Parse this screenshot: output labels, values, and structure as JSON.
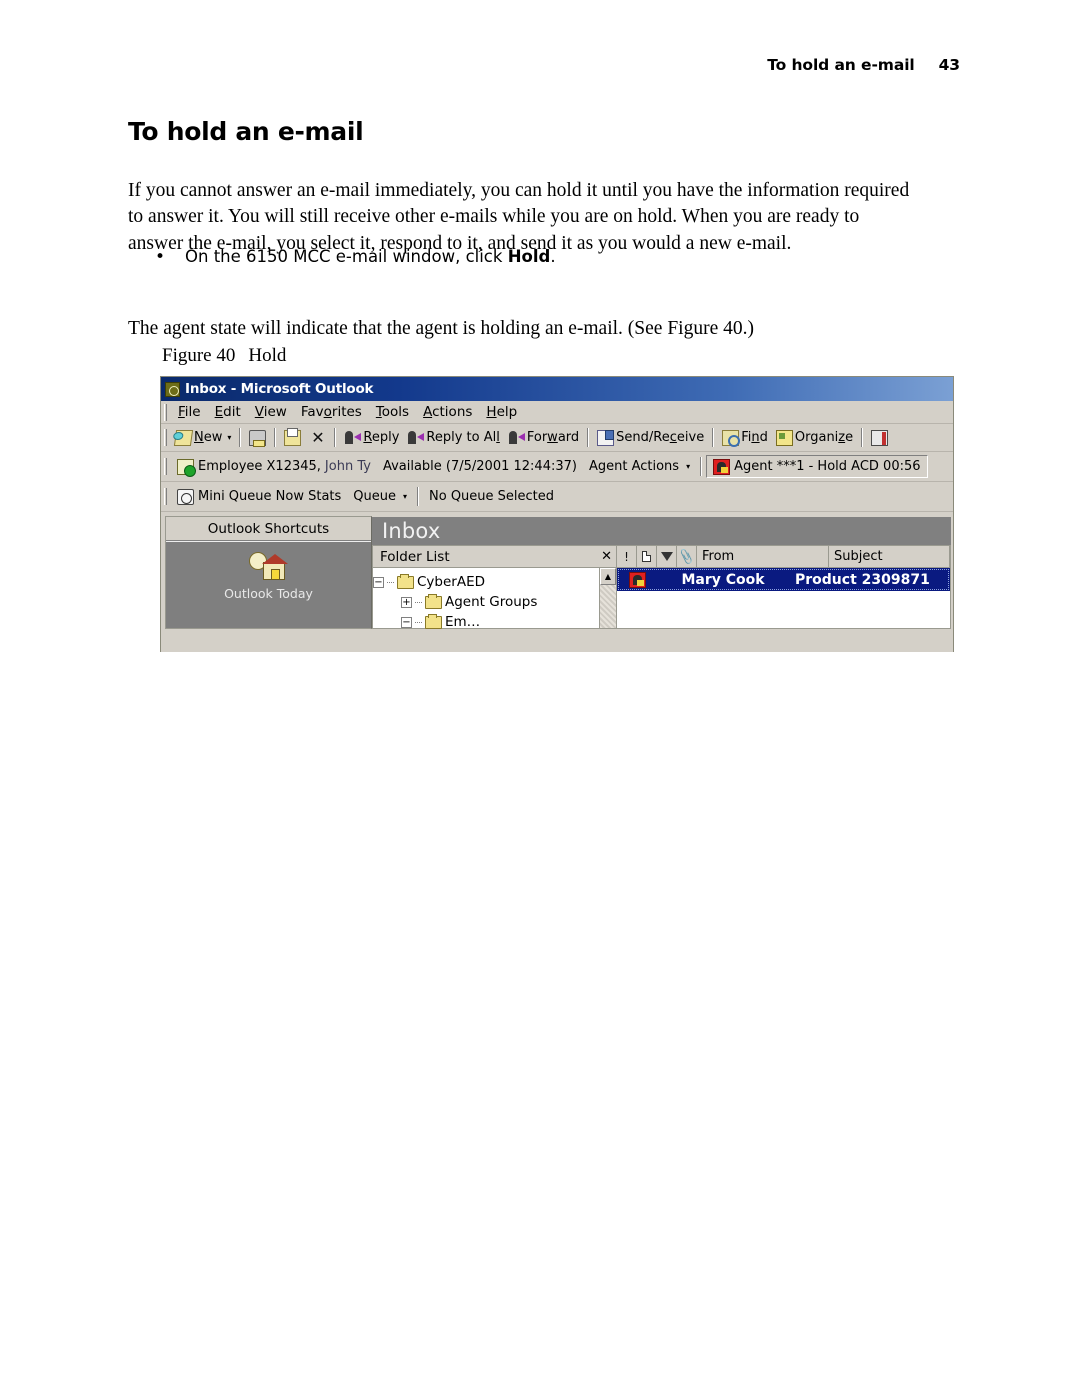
{
  "header": {
    "section_title": "To hold an e-mail",
    "page_number": "43"
  },
  "heading": "To hold an e-mail",
  "paragraphs": {
    "intro": "If you cannot answer an e-mail immediately, you can hold it until you have the information required to answer it. You will still receive other e-mails while you are on hold. When you are ready to answer the e-mail, you select it, respond to it, and send it as you would a new e-mail.",
    "agent_state": "The agent state will indicate that the agent is holding an e-mail. (See Figure 40.)"
  },
  "bullet": {
    "marker": "•",
    "text_before": "On the 6150 MCC e-mail window, click ",
    "emphasis": "Hold",
    "text_after": "."
  },
  "figure": {
    "caption_number": "Figure 40",
    "caption_label": "Hold"
  },
  "screenshot": {
    "titlebar": {
      "text": "Inbox - Microsoft Outlook",
      "icon": "outlook-clock-icon",
      "color": "#13398c"
    },
    "menubar": [
      {
        "pre": "",
        "accel": "F",
        "post": "ile"
      },
      {
        "pre": "",
        "accel": "E",
        "post": "dit"
      },
      {
        "pre": "",
        "accel": "V",
        "post": "iew"
      },
      {
        "pre": "Fav",
        "accel": "o",
        "post": "rites"
      },
      {
        "pre": "",
        "accel": "T",
        "post": "ools"
      },
      {
        "pre": "",
        "accel": "A",
        "post": "ctions"
      },
      {
        "pre": "",
        "accel": "H",
        "post": "elp"
      }
    ],
    "toolbar": {
      "new_label": "New",
      "new_caret": "▾",
      "reply_label": "Reply",
      "reply_all_label": "Reply to All",
      "forward_label": "Forward",
      "send_receive_label": "Send/Receive",
      "find_label": "Find",
      "organize_label": "Organize"
    },
    "agentbar": {
      "employee_label": "Employee X12345,",
      "employee_name": "John Ty",
      "availability": "Available (7/5/2001 12:44:37)",
      "actions_label": "Agent Actions",
      "actions_caret": "▾",
      "status": "Agent ***1 - Hold ACD 00:56",
      "status_icon_color": "#e02020"
    },
    "queuebar": {
      "stats_label": "Mini Queue Now Stats",
      "queue_label": "Queue",
      "queue_caret": "▾",
      "selection": "No Queue Selected"
    },
    "shortcuts": {
      "header": "Outlook Shortcuts",
      "items": [
        {
          "label": "Outlook Today",
          "icon": "outlook-today-icon"
        }
      ]
    },
    "inbox_banner": "Inbox",
    "folder_list": {
      "title": "Folder List",
      "close_label": "✕",
      "scroll_up": "▲",
      "tree": [
        {
          "level": 0,
          "expander": "−",
          "label": "CyberAED"
        },
        {
          "level": 1,
          "expander": "+",
          "label": "Agent Groups"
        },
        {
          "level": 1,
          "expander": "−",
          "label": "Em…"
        }
      ]
    },
    "message_list": {
      "columns": [
        {
          "type": "icon",
          "name": "importance",
          "glyph": "!"
        },
        {
          "type": "icon",
          "name": "item-type",
          "glyph": "page-icon"
        },
        {
          "type": "icon",
          "name": "flag",
          "glyph": "flag-icon"
        },
        {
          "type": "icon",
          "name": "attachment",
          "glyph": "📎"
        },
        {
          "type": "text",
          "name": "from",
          "label": "From"
        },
        {
          "type": "text",
          "name": "subject",
          "label": "Subject"
        }
      ],
      "rows": [
        {
          "icon": "agent-hold-icon",
          "from": "Mary Cook",
          "subject": "Product 2309871",
          "selected": true
        }
      ]
    }
  }
}
